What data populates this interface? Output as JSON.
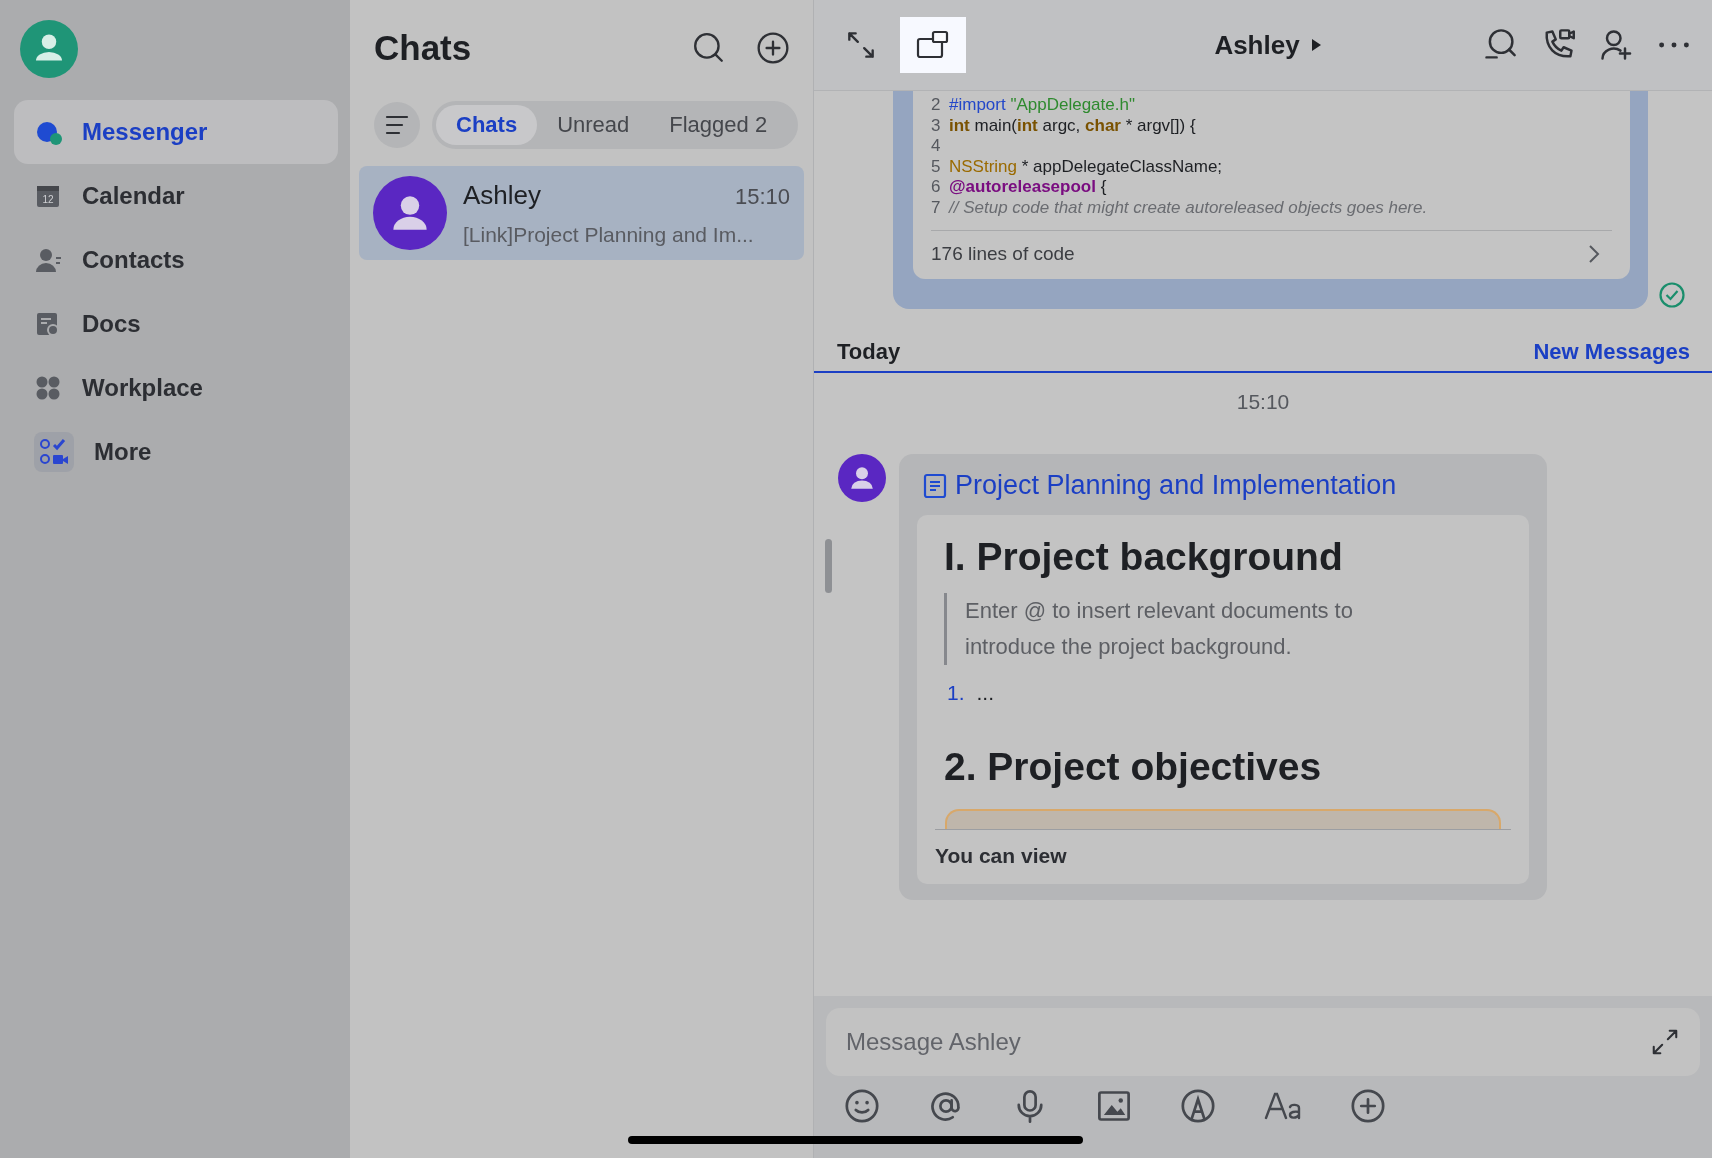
{
  "sidebar": {
    "items": [
      {
        "label": "Messenger",
        "kind": "messenger",
        "selected": true
      },
      {
        "label": "Calendar",
        "kind": "calendar",
        "selected": false,
        "badge": "12"
      },
      {
        "label": "Contacts",
        "kind": "contacts",
        "selected": false
      },
      {
        "label": "Docs",
        "kind": "docs",
        "selected": false
      },
      {
        "label": "Workplace",
        "kind": "workplace",
        "selected": false
      },
      {
        "label": "More",
        "kind": "more",
        "selected": false
      }
    ]
  },
  "chat_list": {
    "title": "Chats",
    "tabs": [
      {
        "label": "Chats",
        "selected": true
      },
      {
        "label": "Unread",
        "selected": false
      },
      {
        "label": "Flagged 2",
        "selected": false
      }
    ],
    "chats": [
      {
        "name": "Ashley",
        "time": "15:10",
        "preview": "[Link]Project Planning and Im...",
        "selected": true
      }
    ]
  },
  "conversation": {
    "title": "Ashley",
    "code_message": {
      "lines": [
        {
          "number": "2",
          "tokens": [
            {
              "text": "#import",
              "kind": "import"
            },
            {
              "text": " \"AppDelegate.h\"",
              "kind": "string"
            }
          ]
        },
        {
          "number": "3",
          "tokens": [
            {
              "text": "int",
              "kind": "keyword"
            },
            {
              "text": " main(",
              "kind": "plain"
            },
            {
              "text": "int",
              "kind": "keyword"
            },
            {
              "text": " argc, ",
              "kind": "plain"
            },
            {
              "text": "char",
              "kind": "keyword"
            },
            {
              "text": " * argv[]) {",
              "kind": "plain"
            }
          ]
        },
        {
          "number": "4"
        },
        {
          "number": "5",
          "tokens": [
            {
              "text": "NSString",
              "kind": "type"
            },
            {
              "text": " * appDelegateClassName;",
              "kind": "plain"
            }
          ]
        },
        {
          "number": "6",
          "tokens": [
            {
              "text": "@autoreleasepool",
              "kind": "directive"
            },
            {
              "text": " {",
              "kind": "plain"
            }
          ]
        },
        {
          "number": "7",
          "tokens": [
            {
              "text": "// Setup code that might create autoreleased objects goes here.",
              "kind": "comment"
            }
          ]
        }
      ],
      "footer": "176 lines of code",
      "read": true
    },
    "divider": {
      "label": "Today",
      "link": "New Messages"
    },
    "timestamp": "15:10",
    "doc_message": {
      "title": "Project Planning and Implementation",
      "heading_1": "I. Project background",
      "quote": "Enter @ to insert relevant documents to introduce the project background.",
      "list_item": {
        "number": "1.",
        "text": "..."
      },
      "heading_2": "2. Project objectives",
      "permission": "You can view"
    },
    "composer": {
      "placeholder": "Message Ashley"
    }
  }
}
